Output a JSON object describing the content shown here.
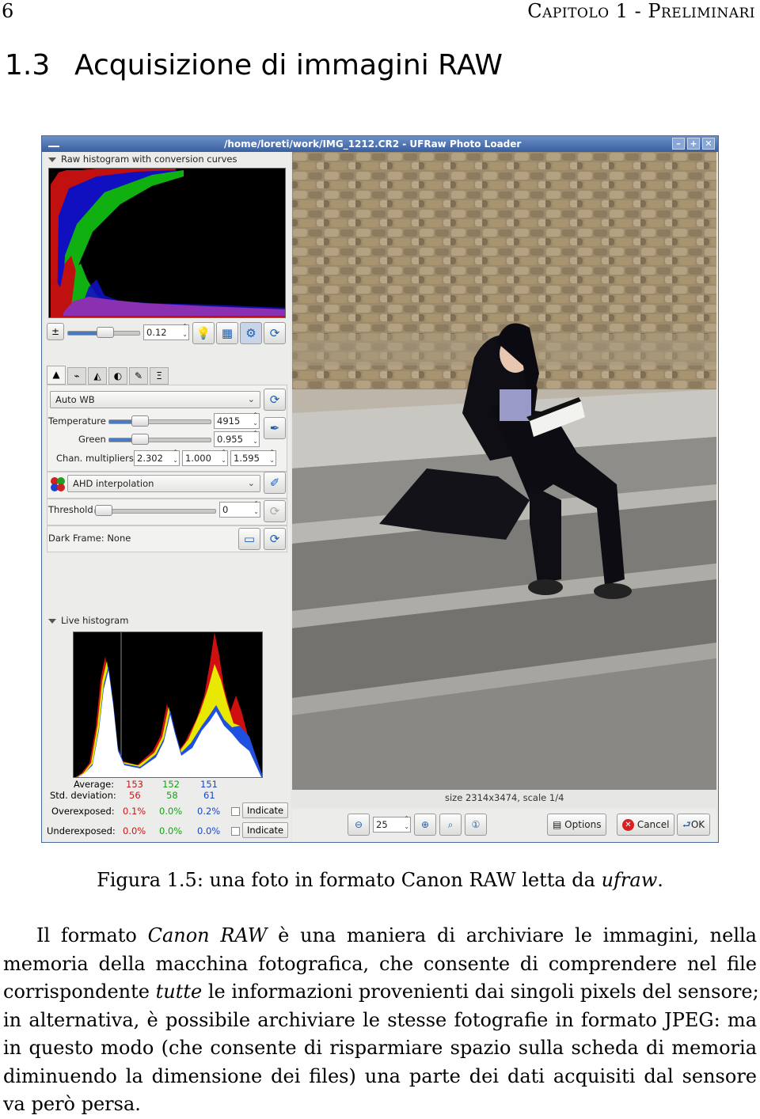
{
  "page": {
    "number": "6",
    "running_head": "Capitolo 1 - Preliminari"
  },
  "section": {
    "number": "1.3",
    "title": "Acquisizione di immagini RAW"
  },
  "window": {
    "title": "/home/loreti/work/IMG_1212.CR2 - UFRaw Photo Loader",
    "raw_histogram_label": "Raw histogram with conversion curves",
    "exposure_value": "0.12",
    "white_balance": "Auto WB",
    "temperature_label": "Temperature",
    "temperature_value": "4915",
    "green_label": "Green",
    "green_value": "0.955",
    "chan_mult_label": "Chan. multipliers:",
    "chan_mult": [
      "2.302",
      "1.000",
      "1.595"
    ],
    "interpolation": "AHD interpolation",
    "threshold_label": "Threshold",
    "threshold_value": "0",
    "dark_frame_label": "Dark Frame:",
    "dark_frame_value": "None",
    "live_histogram_label": "Live histogram",
    "stats": {
      "average_label": "Average:",
      "average": [
        "153",
        "152",
        "151"
      ],
      "std_label": "Std. deviation:",
      "std": [
        "56",
        "58",
        "61"
      ],
      "over_label": "Overexposed:",
      "over": [
        "0.1%",
        "0.0%",
        "0.2%"
      ],
      "under_label": "Underexposed:",
      "under": [
        "0.0%",
        "0.0%",
        "0.0%"
      ],
      "indicate": "Indicate"
    },
    "size_info": "size 2314x3474, scale 1/4",
    "zoom_value": "25",
    "options_label": "Options",
    "cancel_label": "Cancel",
    "ok_label": "OK",
    "accent_color": "#3a5f9f"
  },
  "caption": {
    "prefix": "Figura 1.5: una foto in formato Canon RAW letta da ",
    "app": "ufraw",
    "suffix": "."
  },
  "paragraph": {
    "lines": [
      {
        "a": "Il formato ",
        "i": "Canon RAW",
        "b": " è una maniera di archiviare le immagini, nella"
      },
      {
        "a": "memoria della macchina fotografica, che consente di comprendere nel file"
      },
      {
        "a": "corrispondente ",
        "i": "tutte",
        "b": " le informazioni provenienti dai singoli pixels del sensore;"
      },
      {
        "a": "in alternativa, è possibile archiviare le stesse fotografie in formato JPEG: ma"
      },
      {
        "a": "in questo modo (che consente di risparmiare spazio sulla scheda di memoria"
      },
      {
        "a": "diminuendo la dimensione dei files) una parte dei dati acquisiti dal sensore"
      },
      {
        "a": "va però persa."
      }
    ]
  }
}
